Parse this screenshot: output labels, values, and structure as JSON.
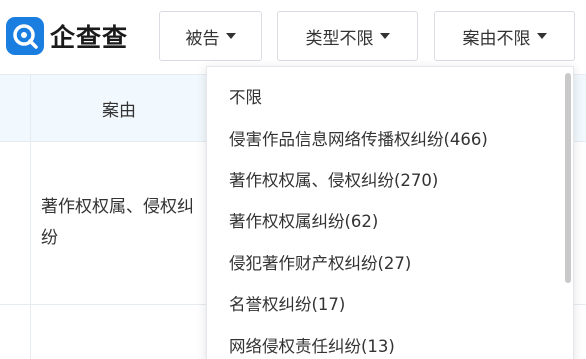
{
  "brand": {
    "name": "企查查",
    "accent": "#1a7de0"
  },
  "filters": {
    "defendant_label": "被告",
    "type_label": "类型不限",
    "cause_label": "案由不限"
  },
  "table": {
    "header_cause": "案由",
    "header_right_fragment": ")",
    "rows": [
      {
        "cause": "著作权权属、侵权纠纷"
      },
      {
        "cause": ""
      }
    ]
  },
  "dropdown": {
    "options": [
      "不限",
      "侵害作品信息网络传播权纠纷(466)",
      "著作权权属、侵权纠纷(270)",
      "著作权权属纠纷(62)",
      "侵犯著作财产权纠纷(27)",
      "名誉权纠纷(17)",
      "网络侵权责任纠纷(13)"
    ]
  }
}
